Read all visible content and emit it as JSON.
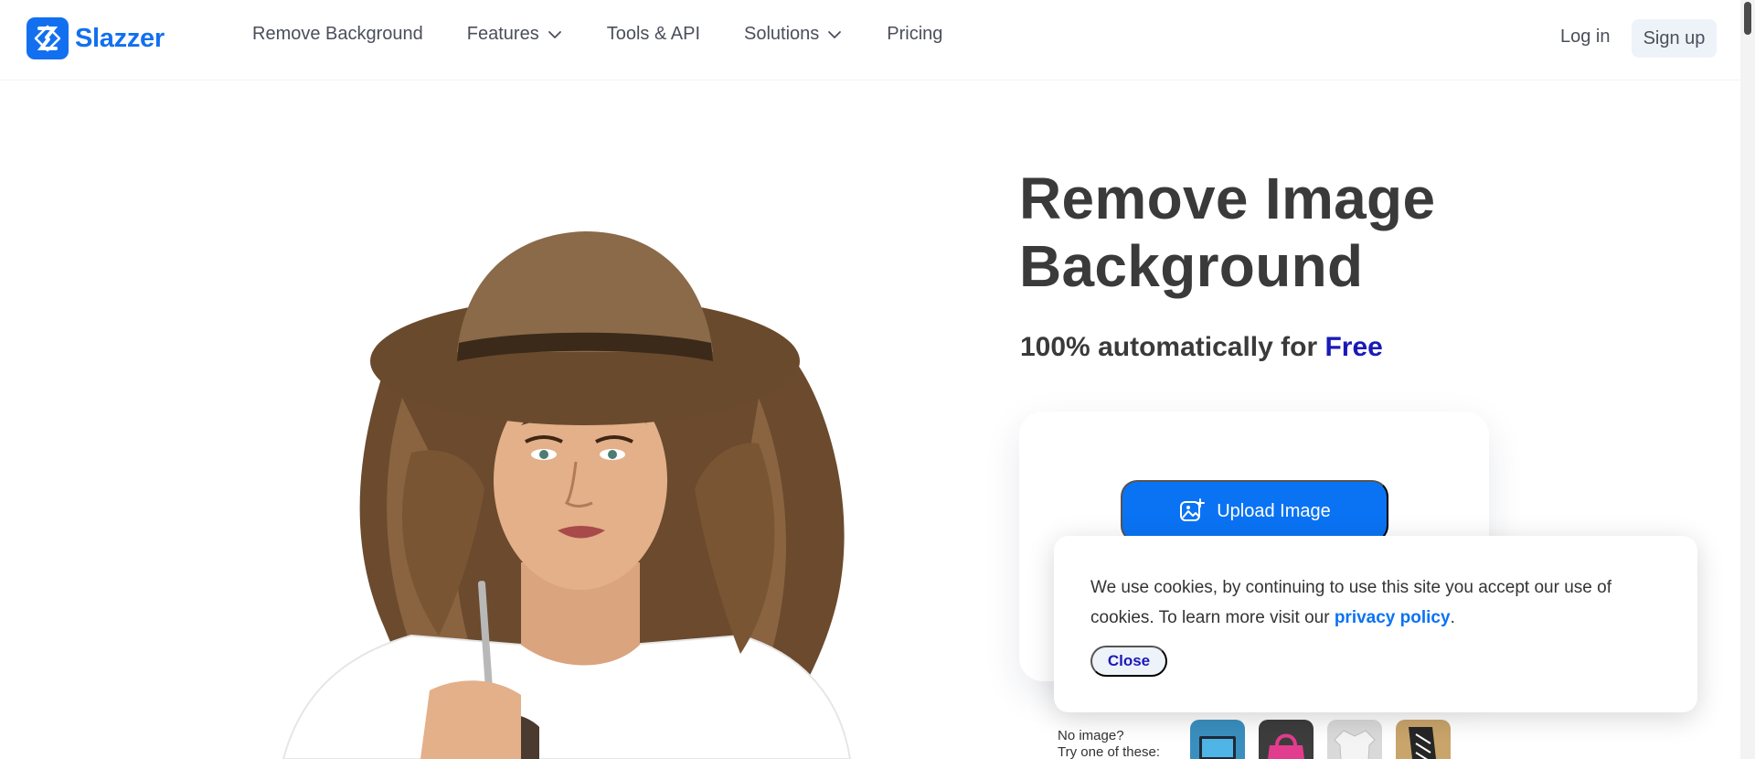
{
  "header": {
    "brand": "Slazzer",
    "nav": [
      {
        "label": "Remove Background",
        "has_dropdown": false
      },
      {
        "label": "Features",
        "has_dropdown": true
      },
      {
        "label": "Tools & API",
        "has_dropdown": false
      },
      {
        "label": "Solutions",
        "has_dropdown": true
      },
      {
        "label": "Pricing",
        "has_dropdown": false
      }
    ],
    "login_label": "Log in",
    "signup_label": "Sign up"
  },
  "hero": {
    "title_line1": "Remove Image",
    "title_line2": "Background",
    "subtitle_prefix": "100% automatically for ",
    "subtitle_highlight": "Free",
    "upload_label": "Upload Image",
    "samples_label_line1": "No image?",
    "samples_label_line2": "Try one of these:"
  },
  "cookie": {
    "text": "We use cookies, by continuing to use this site you accept our use of cookies.  To learn more visit our ",
    "link_label": "privacy policy",
    "period": ".",
    "close_label": "Close"
  },
  "colors": {
    "brand": "#1270f0",
    "accent_blue": "#0a73f4",
    "free_highlight": "#1a1ab8",
    "heading": "#3a3a3a"
  }
}
